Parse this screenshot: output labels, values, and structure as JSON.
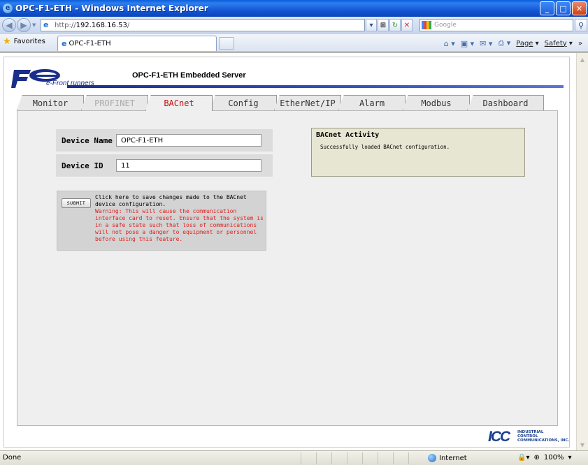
{
  "window": {
    "title": "OPC-F1-ETH - Windows Internet Explorer",
    "minimize": "_",
    "maximize": "□",
    "close": "✕"
  },
  "addressbar": {
    "back_icon": "back-arrow-icon",
    "forward_icon": "forward-arrow-icon",
    "url_prefix": "http://",
    "url_host": "192.168.16.53",
    "url_suffix": "/",
    "search_placeholder": "Google"
  },
  "favbar": {
    "favorites_label": "Favorites",
    "tab_title": "OPC-F1-ETH",
    "commands": [
      {
        "icon": "home-icon",
        "label": ""
      },
      {
        "icon": "feeds-icon",
        "label": ""
      },
      {
        "icon": "mail-icon",
        "label": ""
      },
      {
        "icon": "print-icon",
        "label": ""
      },
      {
        "label": "Page"
      },
      {
        "label": "Safety"
      }
    ]
  },
  "header": {
    "logo_text": "Fe",
    "tagline": "e-Front runners",
    "server_title": "OPC-F1-ETH Embedded Server"
  },
  "tabs": [
    {
      "label": "Monitor",
      "state": "normal"
    },
    {
      "label": "PROFINET",
      "state": "disabled"
    },
    {
      "label": "BACnet",
      "state": "active"
    },
    {
      "label": "Config",
      "state": "normal"
    },
    {
      "label": "EtherNet/IP",
      "state": "normal"
    },
    {
      "label": "Alarm",
      "state": "normal"
    },
    {
      "label": "Modbus",
      "state": "normal"
    },
    {
      "label": "Dashboard",
      "state": "normal"
    }
  ],
  "form": {
    "device_name_label": "Device Name",
    "device_name_value": "OPC-F1-ETH",
    "device_id_label": "Device ID",
    "device_id_value": "11",
    "submit_label": "SUBMIT",
    "submit_text": "Click here to save changes made to the BACnet device configuration.",
    "warning_text": "Warning: This will cause the communication interface card to reset. Ensure that the system is in a safe state such that loss of communications will not pose a danger to equipment or personnel before using this feature."
  },
  "activity": {
    "title": "BACnet Activity",
    "message": "Successfully loaded BACnet configuration."
  },
  "footer_logo": {
    "mark": "ICC",
    "line1": "INDUSTRIAL",
    "line2": "CONTROL",
    "line3": "COMMUNICATIONS, INC."
  },
  "statusbar": {
    "status": "Done",
    "zone": "Internet",
    "zoom": "100%"
  },
  "colors": {
    "active_tab": "#c0100e",
    "warning": "#e02020",
    "brand_blue": "#1a2f8a"
  }
}
